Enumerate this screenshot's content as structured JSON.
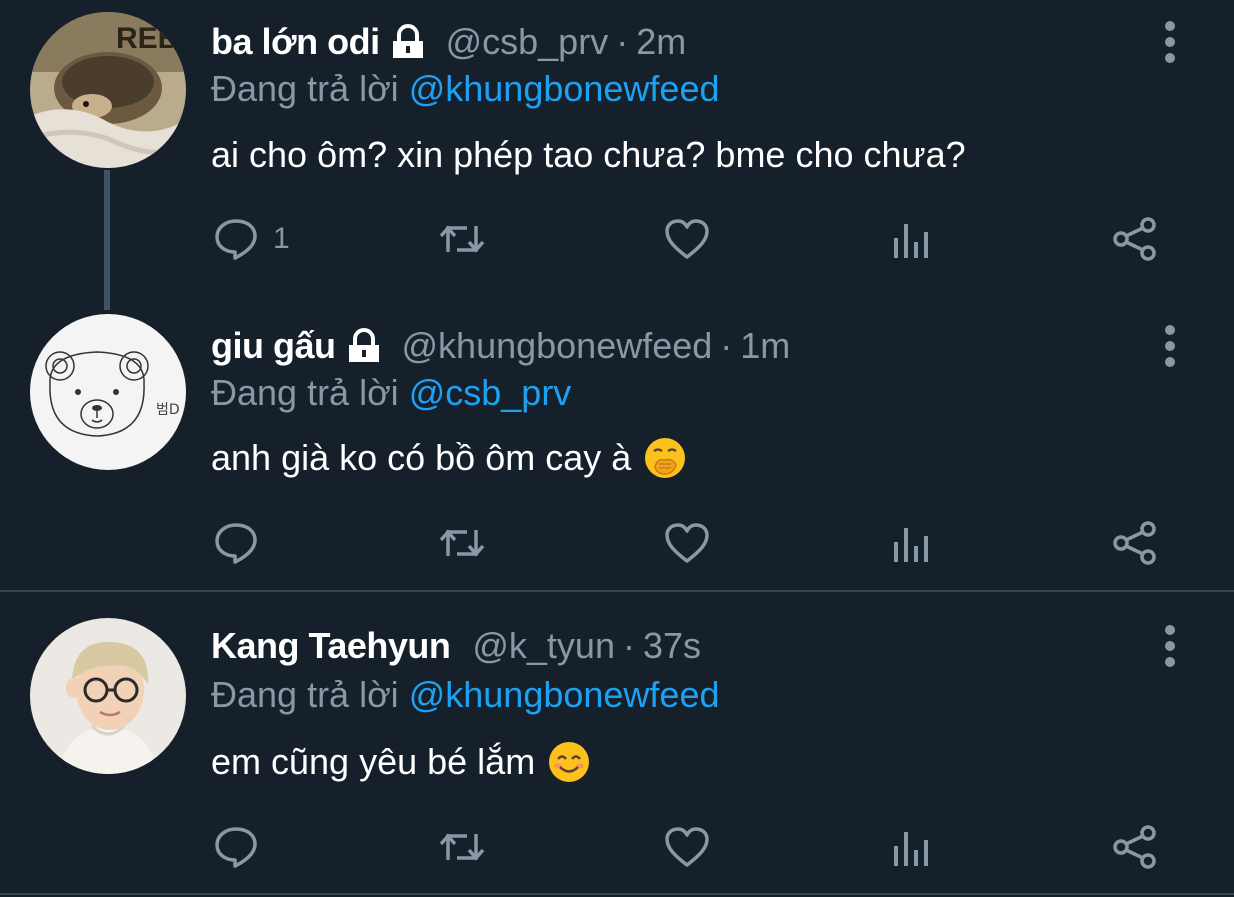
{
  "tweets": [
    {
      "name": "ba lớn odi",
      "handle": "@csb_prv",
      "separator": "·",
      "time": "2m",
      "reply_prefix": "Đang trả lời",
      "reply_to": "@khungbonewfeed",
      "text": "ai cho ôm? xin phép tao chưa? bme cho chưa?",
      "reply_count": "1",
      "locked": true,
      "avatar_icon": "hedgehog-photo"
    },
    {
      "name": "giu gấu",
      "handle": "@khungbonewfeed",
      "separator": "·",
      "time": "1m",
      "reply_prefix": "Đang trả lời",
      "reply_to": "@csb_prv",
      "text": "anh già ko có bồ ôm cay à",
      "emoji": "face-with-hand-over-mouth",
      "locked": true,
      "avatar_icon": "bear-drawing"
    },
    {
      "name": "Kang Taehyun",
      "handle": "@k_tyun",
      "separator": "·",
      "time": "37s",
      "reply_prefix": "Đang trả lời",
      "reply_to": "@khungbonewfeed",
      "text": "em cũng yêu bé lắm",
      "emoji": "smiling-face-with-smiling-eyes",
      "locked": false,
      "avatar_icon": "person-photo"
    }
  ],
  "icons": {
    "reply": "speech-bubble-icon",
    "retweet": "retweet-icon",
    "like": "heart-icon",
    "analytics": "bar-chart-icon",
    "share": "share-icon",
    "more": "vertical-dots-icon",
    "lock": "lock-icon"
  },
  "colors": {
    "background": "#15202b",
    "text": "#ffffff",
    "muted": "#8899a6",
    "link": "#1da1f2",
    "divider": "#38444d"
  }
}
